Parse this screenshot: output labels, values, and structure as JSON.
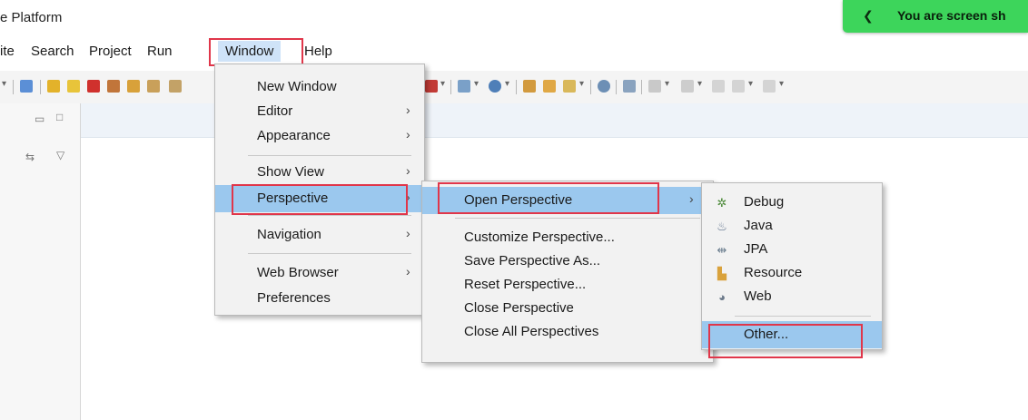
{
  "app": {
    "title": "e Platform",
    "share_banner": "You are screen sh"
  },
  "menubar": {
    "items": [
      "ite",
      "Search",
      "Project",
      "Run",
      "Window",
      "Help"
    ]
  },
  "window_menu": {
    "items": [
      {
        "label": "New Window",
        "has_submenu": false
      },
      {
        "label": "Editor",
        "has_submenu": true
      },
      {
        "label": "Appearance",
        "has_submenu": true
      },
      {
        "label": "Show View",
        "has_submenu": true
      },
      {
        "label": "Perspective",
        "has_submenu": true,
        "highlighted": true
      },
      {
        "label": "Navigation",
        "has_submenu": true
      },
      {
        "label": "Web Browser",
        "has_submenu": true
      },
      {
        "label": "Preferences",
        "has_submenu": false
      }
    ]
  },
  "perspective_menu": {
    "items": [
      {
        "label": "Open Perspective",
        "has_submenu": true,
        "highlighted": true
      },
      {
        "label": "Customize Perspective..."
      },
      {
        "label": "Save Perspective As..."
      },
      {
        "label": "Reset Perspective..."
      },
      {
        "label": "Close Perspective"
      },
      {
        "label": "Close All Perspectives"
      }
    ]
  },
  "open_perspective_menu": {
    "items": [
      {
        "label": "Debug",
        "icon": "debug-icon"
      },
      {
        "label": "Java",
        "icon": "java-icon"
      },
      {
        "label": "JPA",
        "icon": "jpa-icon"
      },
      {
        "label": "Resource",
        "icon": "resource-icon"
      },
      {
        "label": "Web",
        "icon": "web-icon"
      },
      {
        "label": "Other...",
        "icon": "",
        "highlighted": true
      }
    ]
  },
  "colors": {
    "highlight": "#9bc8ee",
    "annotation_red": "#e0364a",
    "banner_green": "#3dd55b"
  }
}
